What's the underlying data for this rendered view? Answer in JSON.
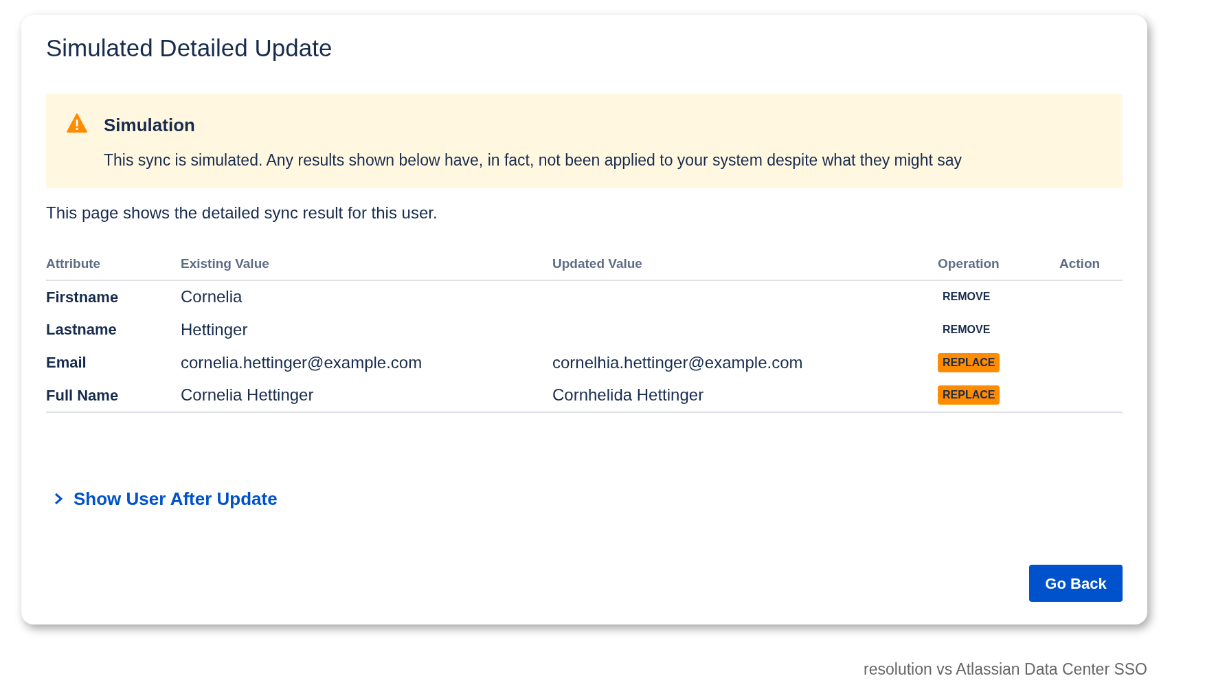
{
  "page_title": "Simulated Detailed Update",
  "warning": {
    "title": "Simulation",
    "message": "This sync is simulated. Any results shown below have, in fact, not been applied to your system despite what they might say"
  },
  "description": "This page shows the detailed sync result for this user.",
  "table": {
    "columns": [
      "Attribute",
      "Existing Value",
      "Updated Value",
      "Operation",
      "Action"
    ],
    "rows": [
      {
        "attribute": "Firstname",
        "existing": "Cornelia",
        "updated": "",
        "operation": {
          "label": "REMOVE",
          "kind": "remove"
        }
      },
      {
        "attribute": "Lastname",
        "existing": "Hettinger",
        "updated": "",
        "operation": {
          "label": "REMOVE",
          "kind": "remove"
        }
      },
      {
        "attribute": "Email",
        "existing": "cornelia.hettinger@example.com",
        "updated": "cornelhia.hettinger@example.com",
        "operation": {
          "label": "REPLACE",
          "kind": "replace"
        }
      },
      {
        "attribute": "Full Name",
        "existing": "Cornelia Hettinger",
        "updated": "Cornhelida Hettinger",
        "operation": {
          "label": "REPLACE",
          "kind": "replace"
        }
      }
    ]
  },
  "expander": {
    "label": "Show User After Update",
    "expanded": false
  },
  "button": "Go Back",
  "caption": "resolution vs Atlassian Data Center SSO"
}
